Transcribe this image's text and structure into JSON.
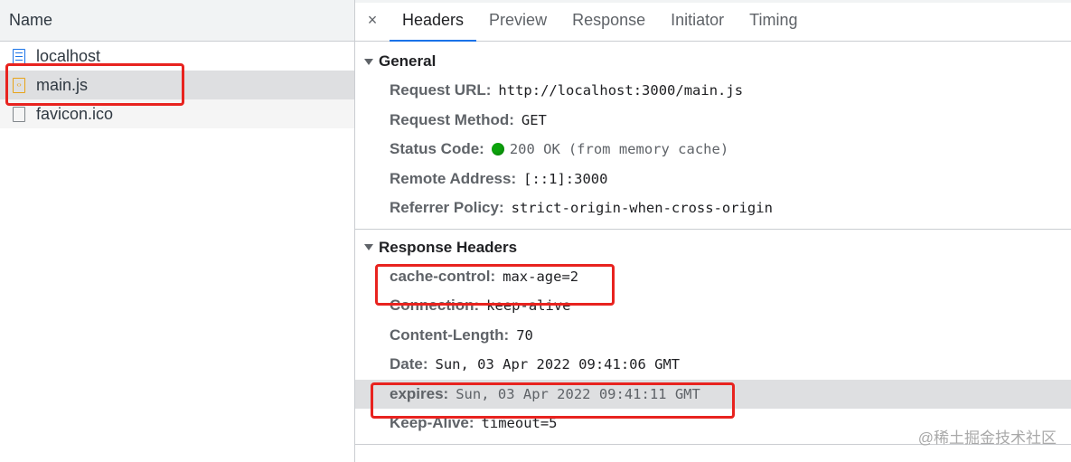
{
  "network_list": {
    "header": "Name",
    "files": [
      {
        "name": "localhost",
        "icon": "document-icon"
      },
      {
        "name": "main.js",
        "icon": "script-file-icon"
      },
      {
        "name": "favicon.ico",
        "icon": "blank-file-icon"
      }
    ]
  },
  "detail": {
    "close_symbol": "×",
    "tabs": [
      "Headers",
      "Preview",
      "Response",
      "Initiator",
      "Timing"
    ],
    "active_tab": "Headers",
    "general": {
      "title": "General",
      "rows": [
        {
          "key": "Request URL:",
          "value": "http://localhost:3000/main.js"
        },
        {
          "key": "Request Method:",
          "value": "GET"
        },
        {
          "key": "Status Code:",
          "value": "200 OK",
          "extra": "(from memory cache)",
          "status_color": "#0ca30c"
        },
        {
          "key": "Remote Address:",
          "value": "[::1]:3000"
        },
        {
          "key": "Referrer Policy:",
          "value": "strict-origin-when-cross-origin"
        }
      ]
    },
    "response_headers": {
      "title": "Response Headers",
      "rows": [
        {
          "key": "cache-control:",
          "value": "max-age=2"
        },
        {
          "key": "Connection:",
          "value": "keep-alive"
        },
        {
          "key": "Content-Length:",
          "value": "70"
        },
        {
          "key": "Date:",
          "value": "Sun, 03 Apr 2022 09:41:06 GMT"
        },
        {
          "key": "expires:",
          "value": "Sun, 03 Apr 2022 09:41:11 GMT"
        },
        {
          "key": "Keep-Alive:",
          "value": "timeout=5"
        }
      ]
    }
  },
  "annotation_color": "#e8231f",
  "watermark": "@稀土掘金技术社区"
}
